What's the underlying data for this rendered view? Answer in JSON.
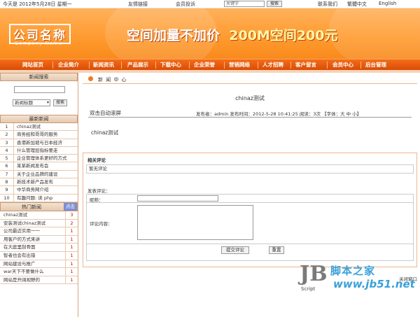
{
  "topbar": {
    "date": "今天是 2012年5月28日 星期一",
    "links": [
      "友情链接",
      "",
      "会员投诉"
    ],
    "search_placeholder": "关键字",
    "search_button": "搜索",
    "right_links": [
      "联系我们",
      "繁體中文",
      "English"
    ]
  },
  "banner": {
    "logo_cn": "公司名称",
    "logo_en": "Company Name",
    "slogan_a": "空间加量不加价",
    "slogan_b": "200M空间200元"
  },
  "nav": [
    "网站首页",
    "企业简介",
    "新闻资讯",
    "产品展示",
    "下载中心",
    "企业荣誉",
    "营销网络",
    "人才招聘",
    "客户留言",
    "会员中心",
    "后台管理"
  ],
  "sidebar": {
    "search_title": "新闻搜索",
    "search_select": "新闻标题",
    "search_button": "搜索",
    "latest_title": "最新新闻",
    "latest": [
      {
        "n": "1",
        "t": "chinaz测试"
      },
      {
        "n": "2",
        "t": "商务经和哥哥的服务"
      },
      {
        "n": "3",
        "t": "香港新加坡与日本经济"
      },
      {
        "n": "4",
        "t": "什么管理层指标要走"
      },
      {
        "n": "5",
        "t": "企业管理体系更好的方式"
      },
      {
        "n": "6",
        "t": "某某新闻发布会"
      },
      {
        "n": "7",
        "t": "关于企业品牌的建设"
      },
      {
        "n": "8",
        "t": "新技术新产品发布"
      },
      {
        "n": "9",
        "t": "中华商务网介绍"
      },
      {
        "n": "10",
        "t": "有趣问题: 读 php"
      }
    ],
    "hot_title": "热门新闻",
    "hot_clicks": "点击",
    "hot": [
      {
        "t": "chinaz测试",
        "c": "3"
      },
      {
        "t": "安装测试chinaz测试",
        "c": "2"
      },
      {
        "t": "公司最近实用一一",
        "c": "1"
      },
      {
        "t": "用客户的方式来讲",
        "c": "1"
      },
      {
        "t": "在大庭里刮骨面",
        "c": "1"
      },
      {
        "t": "智者也会有出错",
        "c": "1"
      },
      {
        "t": "网站建设与推广",
        "c": "1"
      },
      {
        "t": "war天下不要做什么",
        "c": "1"
      },
      {
        "t": "网站是开阔视野的",
        "c": "1"
      }
    ]
  },
  "main": {
    "crumb": "新 闻 中 心",
    "title": "chinaz测试",
    "category": "双击自动滚屏",
    "meta": "发布者：admin 发布时间：2012-5-28 10:41:25 阅读：3次 【字体：大 中 小】",
    "body": "chinaz测试",
    "comments_title": "相关评论",
    "latest_comment": "暂无评论",
    "post_title": "发表评论：",
    "name_label": "昵称：",
    "content_label": "评论内容：",
    "submit": "提交评论",
    "reset": "重置",
    "close": "关闭窗口"
  },
  "watermark": {
    "logo": "JB",
    "script": "Script",
    "cn": "脚本之家",
    "url": "www.jb51.net"
  }
}
